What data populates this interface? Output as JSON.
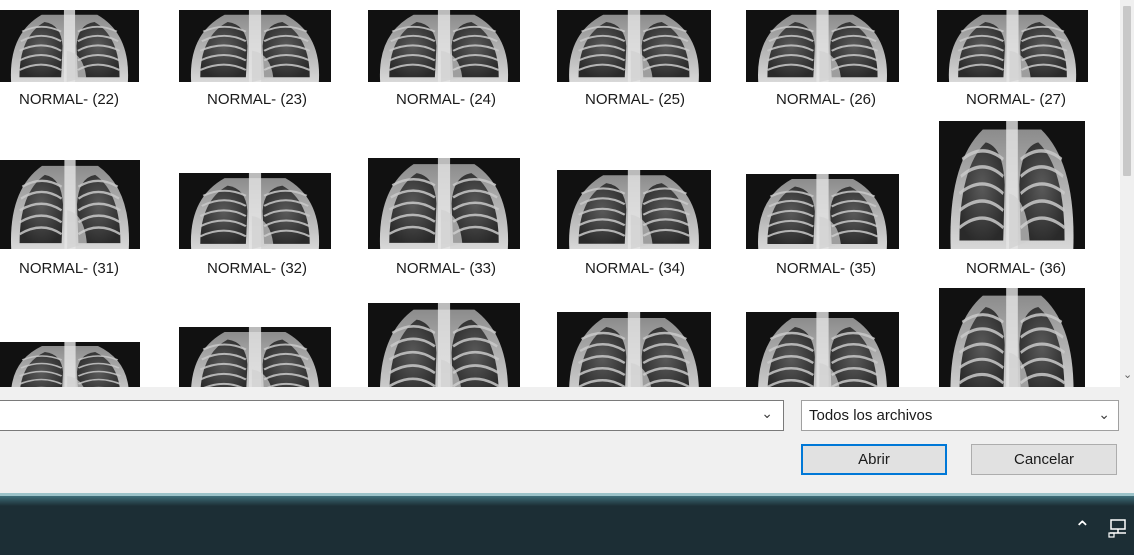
{
  "files": [
    {
      "label": "NORMAL- (22)"
    },
    {
      "label": "NORMAL- (23)"
    },
    {
      "label": "NORMAL- (24)"
    },
    {
      "label": "NORMAL- (25)"
    },
    {
      "label": "NORMAL- (26)"
    },
    {
      "label": "NORMAL- (27)"
    },
    {
      "label": "NORMAL- (31)"
    },
    {
      "label": "NORMAL- (32)"
    },
    {
      "label": "NORMAL- (33)"
    },
    {
      "label": "NORMAL- (34)"
    },
    {
      "label": "NORMAL- (35)"
    },
    {
      "label": "NORMAL- (36)"
    },
    {
      "label": ""
    },
    {
      "label": ""
    },
    {
      "label": ""
    },
    {
      "label": ""
    },
    {
      "label": ""
    },
    {
      "label": ""
    }
  ],
  "dialog": {
    "filename_value": "",
    "filetype_selected": "Todos los archivos",
    "open_label": "Abrir",
    "cancel_label": "Cancelar"
  },
  "icons": {
    "combo_chevron": "chevron-down-icon",
    "tray_chevron": "chevron-up-icon",
    "network": "network-icon"
  },
  "colors": {
    "accent": "#0078d7",
    "taskbar": "#1c2e35"
  }
}
